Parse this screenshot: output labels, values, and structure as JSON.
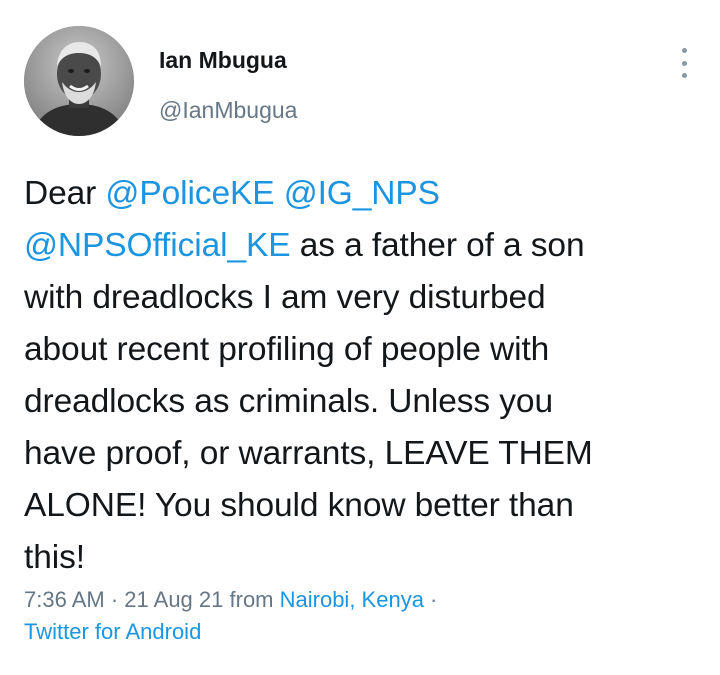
{
  "author": {
    "display_name": "Ian Mbugua",
    "handle": "@IanMbugua",
    "avatar_icon": "person-photo-icon"
  },
  "menu": {
    "icon": "more-vertical-icon"
  },
  "tweet": {
    "lines": [
      {
        "segments": [
          {
            "type": "text",
            "value": "Dear "
          },
          {
            "type": "mention",
            "value": "@PoliceKE"
          },
          {
            "type": "text",
            "value": " "
          },
          {
            "type": "mention",
            "value": "@IG_NPS"
          }
        ]
      },
      {
        "segments": [
          {
            "type": "mention",
            "value": "@NPSOfficial_KE"
          },
          {
            "type": "text",
            "value": " as a father of a son"
          }
        ]
      },
      {
        "segments": [
          {
            "type": "text",
            "value": "with dreadlocks I am very disturbed"
          }
        ]
      },
      {
        "segments": [
          {
            "type": "text",
            "value": "about recent profiling of people with"
          }
        ]
      },
      {
        "segments": [
          {
            "type": "text",
            "value": "dreadlocks as criminals. Unless you"
          }
        ]
      },
      {
        "segments": [
          {
            "type": "text",
            "value": "have proof, or warrants, LEAVE THEM"
          }
        ]
      },
      {
        "segments": [
          {
            "type": "text",
            "value": "ALONE! You should know better than"
          }
        ]
      },
      {
        "segments": [
          {
            "type": "text",
            "value": "this!"
          }
        ]
      }
    ]
  },
  "meta": {
    "time": "7:36 AM",
    "sep1": " · ",
    "date": "21 Aug 21",
    "from_label": " from ",
    "location": "Nairobi, Kenya",
    "sep2": " ·",
    "source": "Twitter for Android"
  },
  "colors": {
    "link": "#1b95e0",
    "text": "#14171a",
    "muted": "#657786"
  }
}
